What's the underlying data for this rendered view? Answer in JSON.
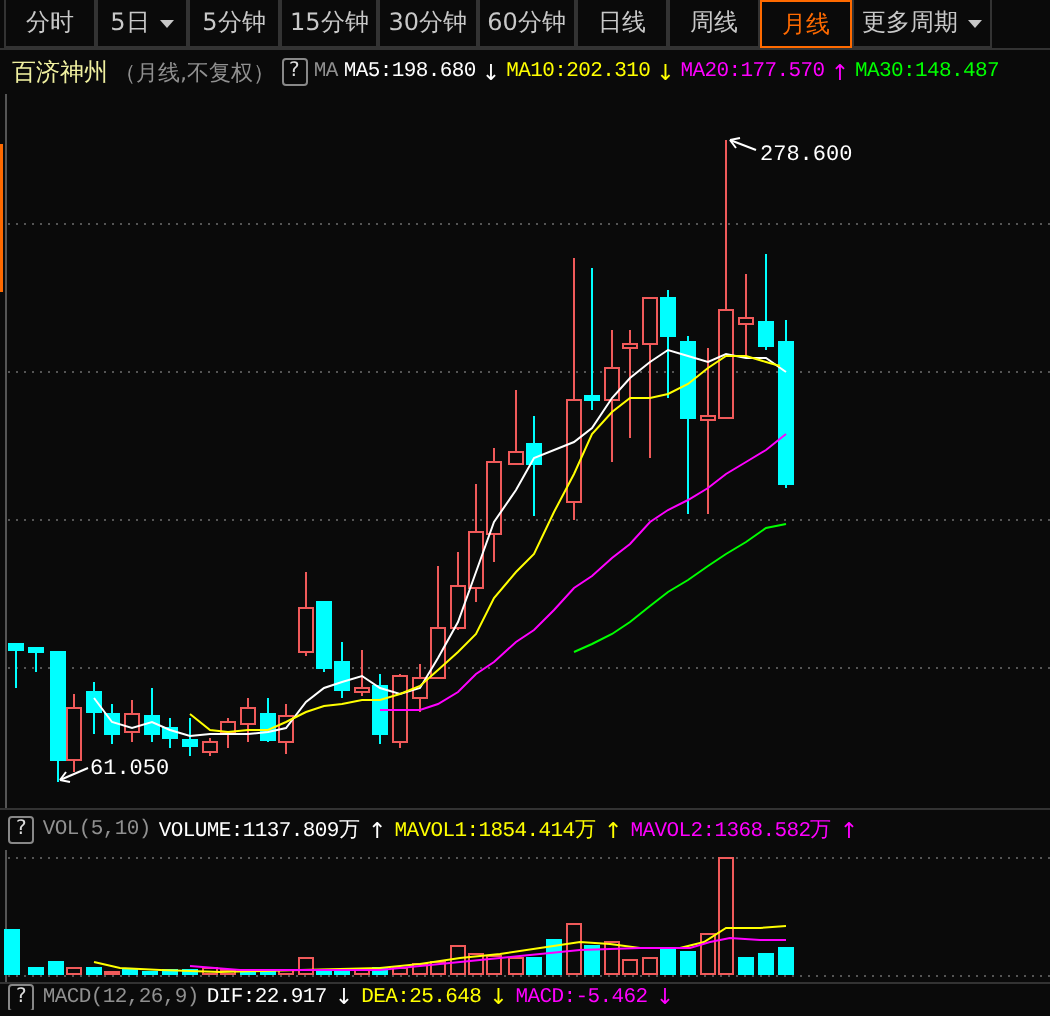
{
  "tabs": [
    {
      "label": "分时",
      "selected": false,
      "dropdown": false
    },
    {
      "label": "5日",
      "selected": false,
      "dropdown": true
    },
    {
      "label": "5分钟",
      "selected": false,
      "dropdown": false
    },
    {
      "label": "15分钟",
      "selected": false,
      "dropdown": false
    },
    {
      "label": "30分钟",
      "selected": false,
      "dropdown": false
    },
    {
      "label": "60分钟",
      "selected": false,
      "dropdown": false
    },
    {
      "label": "日线",
      "selected": false,
      "dropdown": false
    },
    {
      "label": "周线",
      "selected": false,
      "dropdown": false
    },
    {
      "label": "月线",
      "selected": true,
      "dropdown": false
    },
    {
      "label": "更多周期",
      "selected": false,
      "dropdown": true
    }
  ],
  "stock": {
    "name": "百济神州",
    "mode": "（月线,不复权）",
    "help": "?",
    "indicator": "MA"
  },
  "ma_legend": [
    {
      "text": "MA5:198.680",
      "arrow": "↓",
      "color": "#ffffff"
    },
    {
      "text": "MA10:202.310",
      "arrow": "↓",
      "color": "#ffff00"
    },
    {
      "text": "MA20:177.570",
      "arrow": "↑",
      "color": "#ff00ff"
    },
    {
      "text": "MA30:148.487",
      "color": "#00ff00"
    }
  ],
  "price_chart": {
    "high_label": "278.600",
    "low_label": "61.050"
  },
  "volume": {
    "help": "?",
    "indicator": "VOL(5,10)",
    "legend": [
      {
        "text": "VOLUME:1137.809万",
        "arrow": "↑",
        "color": "#ffffff"
      },
      {
        "text": "MAVOL1:1854.414万",
        "arrow": "↑",
        "color": "#ffff00"
      },
      {
        "text": "MAVOL2:1368.582万",
        "arrow": "↑",
        "color": "#ff00ff"
      }
    ]
  },
  "macd": {
    "help": "?",
    "indicator": "MACD(12,26,9)",
    "legend": [
      {
        "text": "DIF:22.917",
        "arrow": "↓",
        "color": "#ffffff"
      },
      {
        "text": "DEA:25.648",
        "arrow": "↓",
        "color": "#ffff00"
      },
      {
        "text": "MACD:-5.462",
        "arrow": "↓",
        "color": "#ff00ff"
      }
    ]
  }
}
